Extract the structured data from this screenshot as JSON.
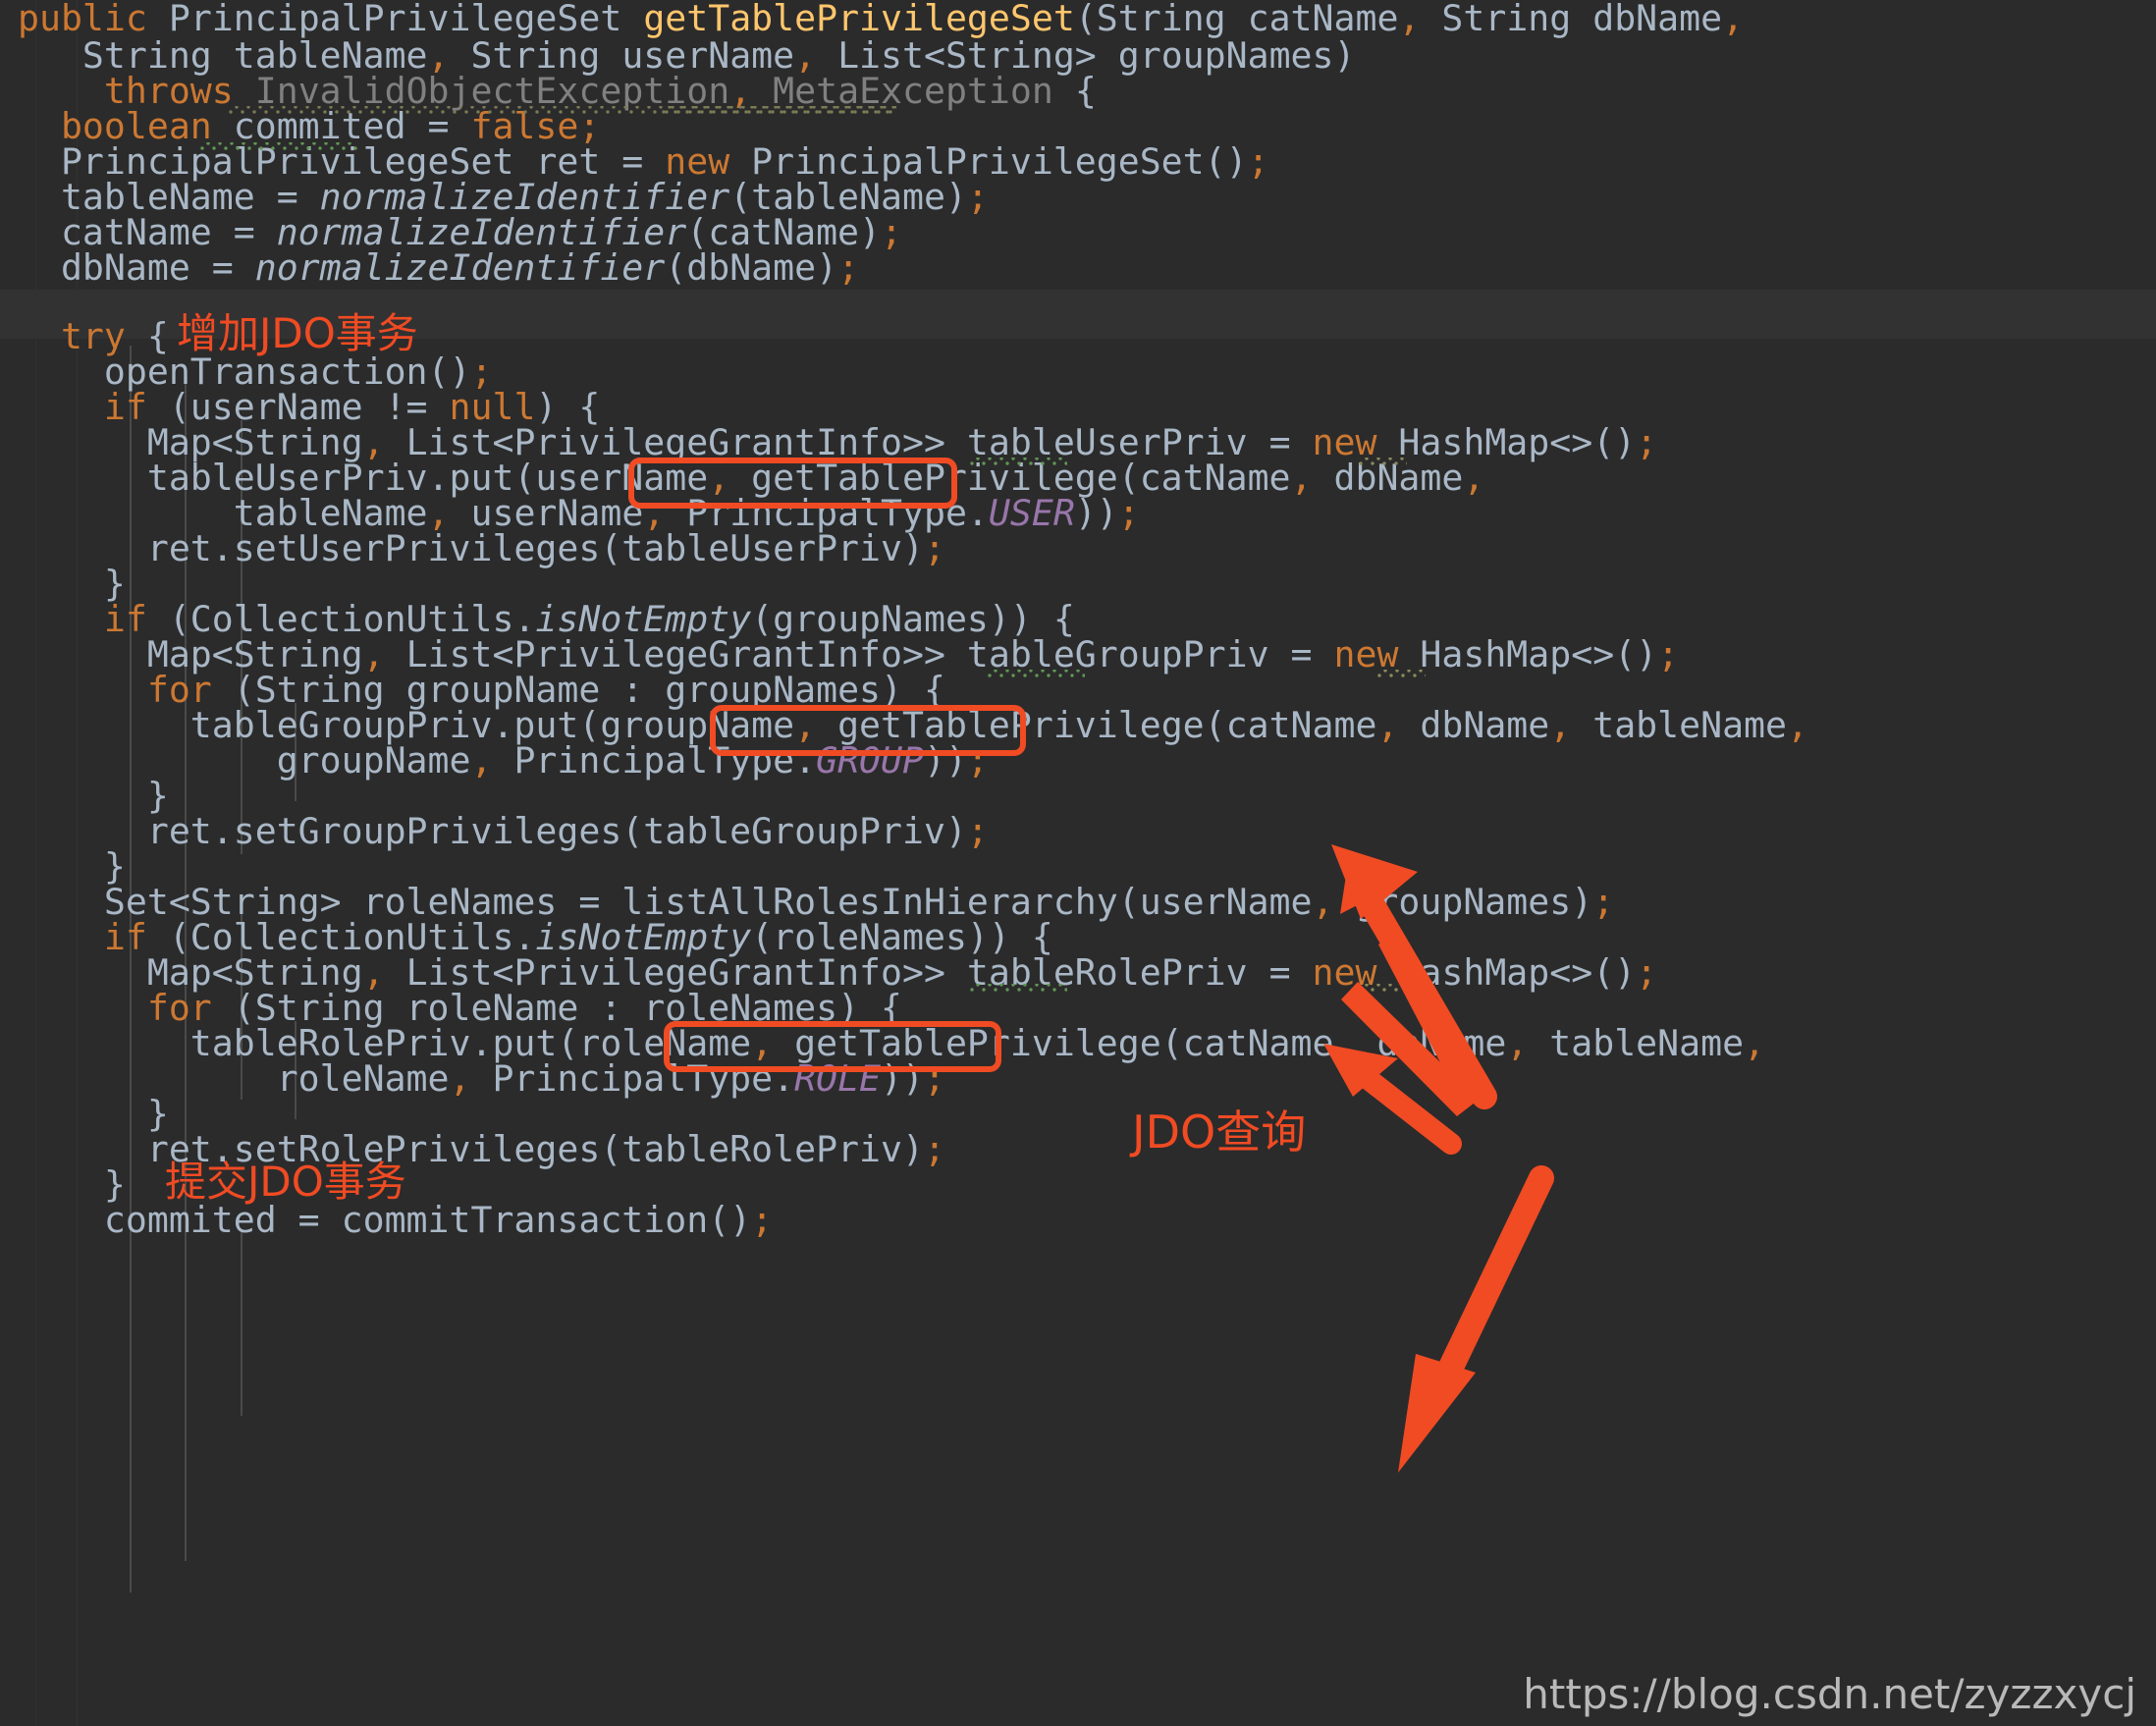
{
  "editor": {
    "theme_background": "#2b2b2b",
    "default_text_color": "#a9b7c6",
    "keyword_color": "#cc7832",
    "method_color": "#ffc66d",
    "static_const_color": "#9876aa",
    "dim_color": "#808080",
    "caret_row_color": "#323232",
    "language": "Java"
  },
  "annotations": {
    "accent_color": "#f04b23",
    "labels": {
      "add_jdo_transaction": "增加JDO事务",
      "jdo_query": "JDO查询",
      "commit_jdo_transaction": "提交JDO事务"
    },
    "boxed_token": "getTablePrivilege",
    "boxed_token_with_paren": "getTablePrivilege("
  },
  "watermark": {
    "url": "https://blog.csdn.net/zyzzxycj"
  },
  "code": {
    "lines": [
      "public PrincipalPrivilegeSet getTablePrivilegeSet(String catName, String dbName,",
      "   String tableName, String userName, List<String> groupNames)",
      "    throws InvalidObjectException, MetaException {",
      "  boolean commited = false;",
      "  PrincipalPrivilegeSet ret = new PrincipalPrivilegeSet();",
      "  tableName = normalizeIdentifier(tableName);",
      "  catName = normalizeIdentifier(catName);",
      "  dbName = normalizeIdentifier(dbName);",
      "",
      "  try {",
      "    openTransaction();",
      "    if (userName != null) {",
      "      Map<String, List<PrivilegeGrantInfo>> tableUserPriv = new HashMap<>();",
      "      tableUserPriv.put(userName, getTablePrivilege(catName, dbName,",
      "          tableName, userName, PrincipalType.USER));",
      "      ret.setUserPrivileges(tableUserPriv);",
      "    }",
      "    if (CollectionUtils.isNotEmpty(groupNames)) {",
      "      Map<String, List<PrivilegeGrantInfo>> tableGroupPriv = new HashMap<>();",
      "      for (String groupName : groupNames) {",
      "        tableGroupPriv.put(groupName, getTablePrivilege(catName, dbName, tableName,",
      "            groupName, PrincipalType.GROUP));",
      "      }",
      "      ret.setGroupPrivileges(tableGroupPriv);",
      "    }",
      "    Set<String> roleNames = listAllRolesInHierarchy(userName, groupNames);",
      "    if (CollectionUtils.isNotEmpty(roleNames)) {",
      "      Map<String, List<PrivilegeGrantInfo>> tableRolePriv = new HashMap<>();",
      "      for (String roleName : roleNames) {",
      "        tableRolePriv.put(roleName, getTablePrivilege(catName, dbName, tableName,",
      "            roleName, PrincipalType.ROLE));",
      "      }",
      "      ret.setRolePrivileges(tableRolePriv);",
      "    }",
      "    commited = commitTransaction();"
    ],
    "identifiers": {
      "method_name": "getTablePrivilegeSet",
      "return_type": "PrincipalPrivilegeSet",
      "exceptions": [
        "InvalidObjectException",
        "MetaException"
      ],
      "principal_types": [
        "USER",
        "GROUP",
        "ROLE"
      ],
      "helper_methods": [
        "normalizeIdentifier",
        "isNotEmpty",
        "openTransaction",
        "commitTransaction",
        "listAllRolesInHierarchy",
        "getTablePrivilege"
      ]
    }
  }
}
